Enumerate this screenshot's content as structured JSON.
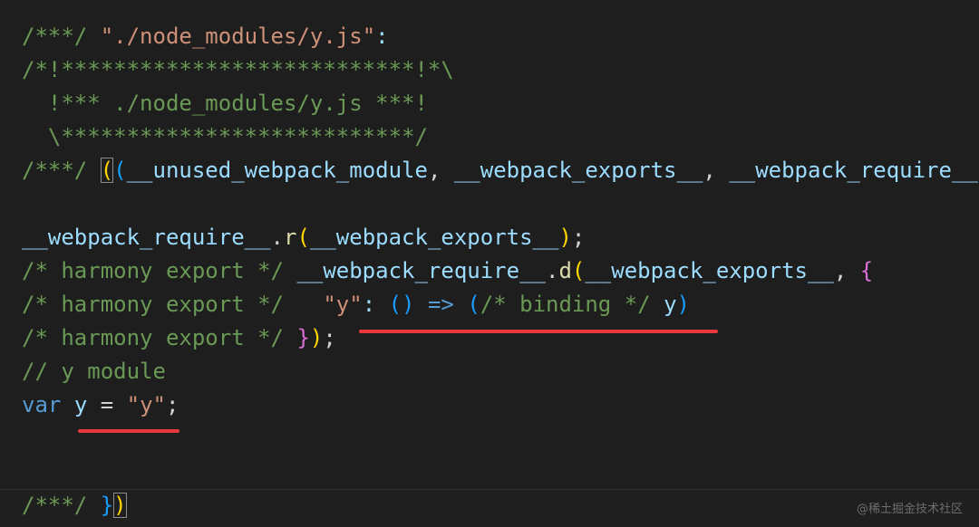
{
  "editor": {
    "lines": [
      {
        "tokens": [
          {
            "text": "/***/ ",
            "kind": "comment"
          },
          {
            "text": "\"./node_modules/y.js\"",
            "kind": "string"
          },
          {
            "text": ":",
            "kind": "ident"
          }
        ]
      },
      {
        "tokens": [
          {
            "text": "/*!***************************!*\\",
            "kind": "comment"
          }
        ]
      },
      {
        "tokens": [
          {
            "text": "  !*** ./node_modules/y.js ***!",
            "kind": "comment"
          }
        ]
      },
      {
        "tokens": [
          {
            "text": "  \\***************************/",
            "kind": "comment"
          }
        ]
      },
      {
        "tokens": [
          {
            "text": "/***/ ",
            "kind": "comment"
          },
          {
            "text": "(",
            "kind": "b1",
            "boxed": true
          },
          {
            "text": "(",
            "kind": "b3"
          },
          {
            "text": "__unused_webpack_module",
            "kind": "ident"
          },
          {
            "text": ", ",
            "kind": "punct"
          },
          {
            "text": "__webpack_exports__",
            "kind": "ident"
          },
          {
            "text": ", ",
            "kind": "punct"
          },
          {
            "text": "__webpack_require__",
            "kind": "ident"
          }
        ]
      },
      {
        "tokens": []
      },
      {
        "tokens": [
          {
            "text": "__webpack_require__",
            "kind": "ident"
          },
          {
            "text": ".",
            "kind": "punct"
          },
          {
            "text": "r",
            "kind": "func"
          },
          {
            "text": "(",
            "kind": "b1"
          },
          {
            "text": "__webpack_exports__",
            "kind": "ident"
          },
          {
            "text": ")",
            "kind": "b1"
          },
          {
            "text": ";",
            "kind": "punct"
          }
        ]
      },
      {
        "tokens": [
          {
            "text": "/* harmony export */ ",
            "kind": "comment"
          },
          {
            "text": "__webpack_require__",
            "kind": "ident"
          },
          {
            "text": ".",
            "kind": "punct"
          },
          {
            "text": "d",
            "kind": "func"
          },
          {
            "text": "(",
            "kind": "b1"
          },
          {
            "text": "__webpack_exports__",
            "kind": "ident"
          },
          {
            "text": ", ",
            "kind": "punct"
          },
          {
            "text": "{",
            "kind": "b2"
          }
        ]
      },
      {
        "tokens": [
          {
            "text": "/* harmony export */   ",
            "kind": "comment"
          },
          {
            "text": "\"y\"",
            "kind": "string"
          },
          {
            "text": ": ",
            "kind": "ident"
          },
          {
            "text": "()",
            "kind": "b3"
          },
          {
            "text": " => ",
            "kind": "keyword"
          },
          {
            "text": "(",
            "kind": "b3"
          },
          {
            "text": "/* binding */",
            "kind": "comment"
          },
          {
            "text": " ",
            "kind": "punct"
          },
          {
            "text": "y",
            "kind": "ident"
          },
          {
            "text": ")",
            "kind": "b3"
          }
        ]
      },
      {
        "tokens": [
          {
            "text": "/* harmony export */ ",
            "kind": "comment"
          },
          {
            "text": "}",
            "kind": "b2"
          },
          {
            "text": ")",
            "kind": "b1"
          },
          {
            "text": ";",
            "kind": "punct"
          }
        ]
      },
      {
        "tokens": [
          {
            "text": "// y module",
            "kind": "comment"
          }
        ]
      },
      {
        "tokens": [
          {
            "text": "var",
            "kind": "keyword"
          },
          {
            "text": " ",
            "kind": "punct"
          },
          {
            "text": "y",
            "kind": "ident"
          },
          {
            "text": " = ",
            "kind": "punct"
          },
          {
            "text": "\"y\"",
            "kind": "string"
          },
          {
            "text": ";",
            "kind": "punct"
          }
        ]
      },
      {
        "tokens": []
      },
      {
        "tokens": []
      },
      {
        "tokens": [
          {
            "text": "/***/ ",
            "kind": "comment"
          },
          {
            "text": "}",
            "kind": "b3"
          },
          {
            "text": ")",
            "kind": "b1",
            "boxed": true
          }
        ]
      }
    ]
  },
  "colors": {
    "background": "#1e1e1e",
    "comment": "#6a9955",
    "string": "#ce9178",
    "identifier": "#9cdcfe",
    "function": "#dcdcaa",
    "keyword": "#569cd6",
    "bracket_gold": "#ffd700",
    "bracket_orchid": "#da70d6",
    "bracket_blue": "#179fff",
    "annotation_red": "#e8383d"
  },
  "watermark": "@稀土掘金技术社区"
}
